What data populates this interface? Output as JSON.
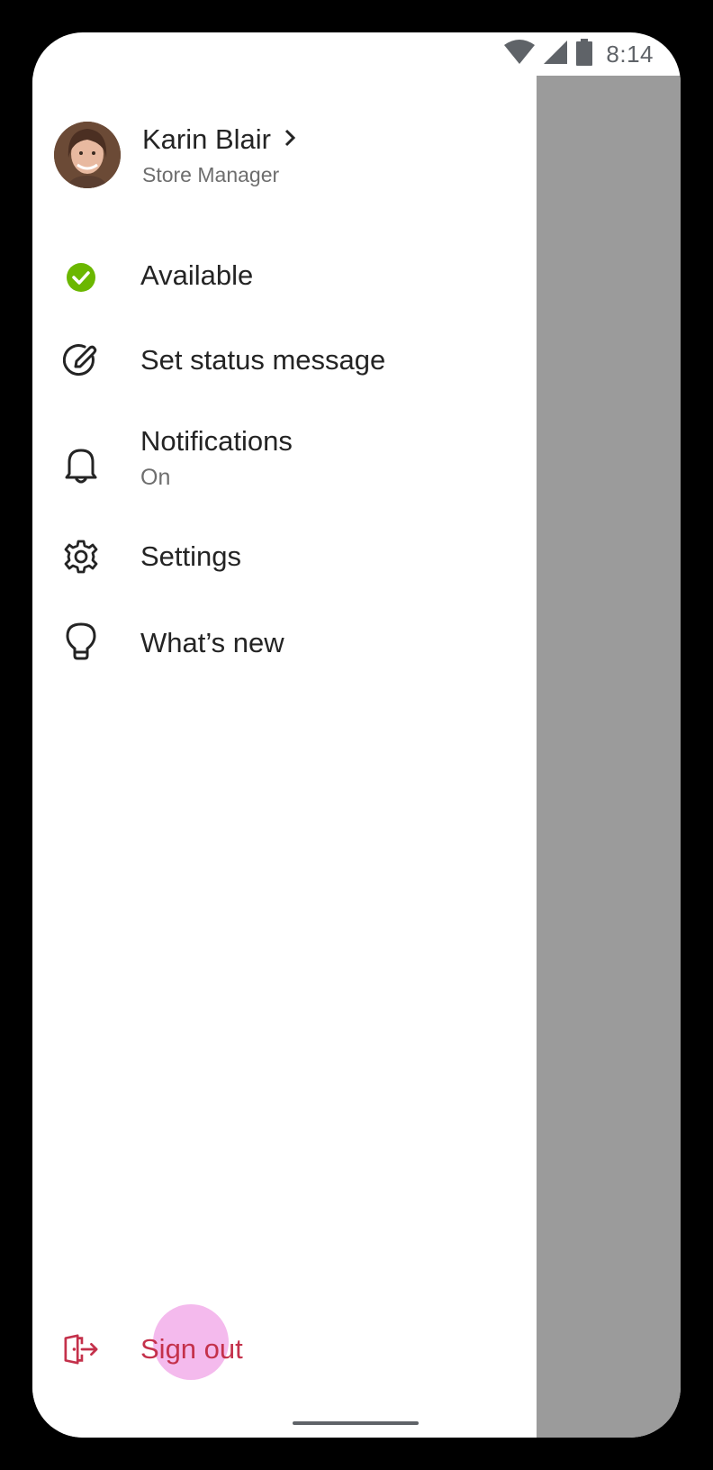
{
  "status_bar": {
    "time": "8:14",
    "icons": [
      "wifi-icon",
      "cellular-signal-icon",
      "battery-icon"
    ]
  },
  "profile": {
    "name": "Karin Blair",
    "role": "Store Manager",
    "avatar": "user-avatar"
  },
  "menu": {
    "availability": {
      "label": "Available",
      "icon": "available-check-icon",
      "color": "#6bb700"
    },
    "status_message": {
      "label": "Set status message",
      "icon": "edit-pencil-icon"
    },
    "notifications": {
      "label": "Notifications",
      "sub": "On",
      "icon": "bell-icon"
    },
    "settings": {
      "label": "Settings",
      "icon": "gear-icon"
    },
    "whats_new": {
      "label": "What’s new",
      "icon": "lightbulb-icon"
    },
    "sign_out": {
      "label": "Sign out",
      "icon": "sign-out-door-icon",
      "color": "#c4314b"
    }
  },
  "colors": {
    "scrim": "#9b9b9b",
    "text_primary": "#242424",
    "text_secondary": "#6e6e6e",
    "touch_ripple": "#ec8ce1"
  }
}
